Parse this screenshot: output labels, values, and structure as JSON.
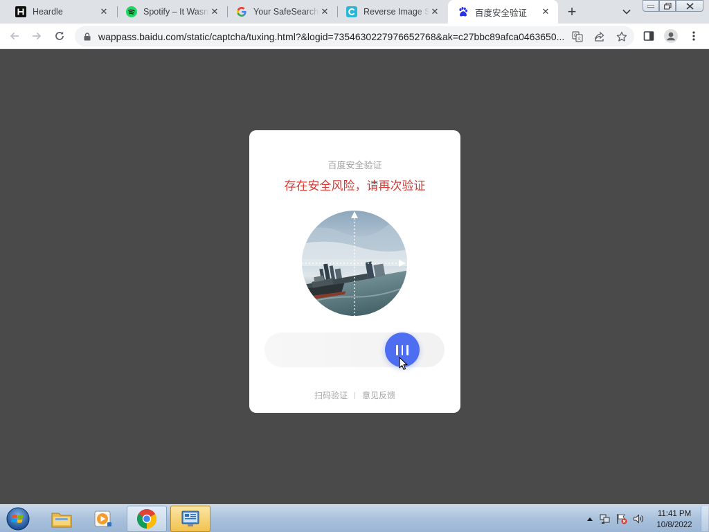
{
  "tabs": [
    {
      "title": "Heardle",
      "icon": "heardle-icon",
      "active": false
    },
    {
      "title": "Spotify – It Wasn't Me",
      "icon": "spotify-icon",
      "active": false
    },
    {
      "title": "Your SafeSearch Settings",
      "icon": "google-icon",
      "active": false
    },
    {
      "title": "Reverse Image Search",
      "icon": "reverse-image-icon",
      "active": false
    },
    {
      "title": "百度安全验证",
      "icon": "baidu-icon",
      "active": true
    }
  ],
  "address_bar": {
    "url": "wappass.baidu.com/static/captcha/tuxing.html?&logid=7354630227976652768&ak=c27bbc89afca0463650..."
  },
  "captcha": {
    "small_title": "百度安全验证",
    "warning_title": "存在安全风险，请再次验证",
    "footer_links": [
      "扫码验证",
      "意见反馈"
    ],
    "slider_handle": "drag-handle-icon"
  },
  "taskbar": {
    "apps": [
      "file-explorer-icon",
      "media-player-icon",
      "chrome-icon",
      "control-panel-icon"
    ],
    "clock_time": "11:41 PM",
    "clock_date": "10/8/2022"
  },
  "colors": {
    "page_background": "#4a4a4a",
    "warning_red": "#d73a35",
    "slider_blue": "#4e6ef2",
    "tabstrip": "#dee1e6"
  }
}
